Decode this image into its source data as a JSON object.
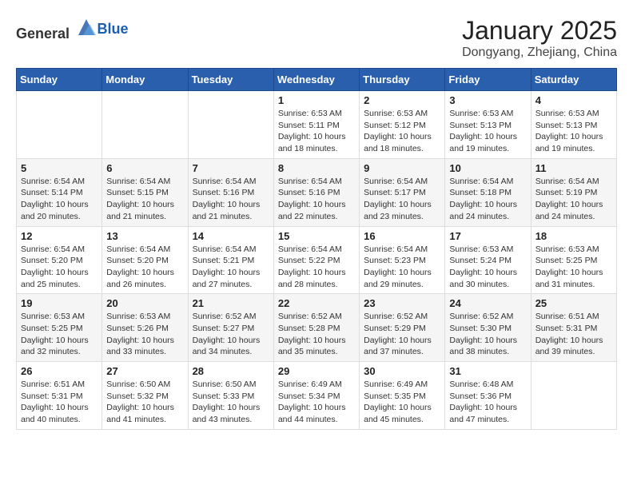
{
  "header": {
    "logo": {
      "general": "General",
      "blue": "Blue"
    },
    "month": "January 2025",
    "location": "Dongyang, Zhejiang, China"
  },
  "weekdays": [
    "Sunday",
    "Monday",
    "Tuesday",
    "Wednesday",
    "Thursday",
    "Friday",
    "Saturday"
  ],
  "weeks": [
    [
      {
        "day": "",
        "info": ""
      },
      {
        "day": "",
        "info": ""
      },
      {
        "day": "",
        "info": ""
      },
      {
        "day": "1",
        "info": "Sunrise: 6:53 AM\nSunset: 5:11 PM\nDaylight: 10 hours and 18 minutes."
      },
      {
        "day": "2",
        "info": "Sunrise: 6:53 AM\nSunset: 5:12 PM\nDaylight: 10 hours and 18 minutes."
      },
      {
        "day": "3",
        "info": "Sunrise: 6:53 AM\nSunset: 5:13 PM\nDaylight: 10 hours and 19 minutes."
      },
      {
        "day": "4",
        "info": "Sunrise: 6:53 AM\nSunset: 5:13 PM\nDaylight: 10 hours and 19 minutes."
      }
    ],
    [
      {
        "day": "5",
        "info": "Sunrise: 6:54 AM\nSunset: 5:14 PM\nDaylight: 10 hours and 20 minutes."
      },
      {
        "day": "6",
        "info": "Sunrise: 6:54 AM\nSunset: 5:15 PM\nDaylight: 10 hours and 21 minutes."
      },
      {
        "day": "7",
        "info": "Sunrise: 6:54 AM\nSunset: 5:16 PM\nDaylight: 10 hours and 21 minutes."
      },
      {
        "day": "8",
        "info": "Sunrise: 6:54 AM\nSunset: 5:16 PM\nDaylight: 10 hours and 22 minutes."
      },
      {
        "day": "9",
        "info": "Sunrise: 6:54 AM\nSunset: 5:17 PM\nDaylight: 10 hours and 23 minutes."
      },
      {
        "day": "10",
        "info": "Sunrise: 6:54 AM\nSunset: 5:18 PM\nDaylight: 10 hours and 24 minutes."
      },
      {
        "day": "11",
        "info": "Sunrise: 6:54 AM\nSunset: 5:19 PM\nDaylight: 10 hours and 24 minutes."
      }
    ],
    [
      {
        "day": "12",
        "info": "Sunrise: 6:54 AM\nSunset: 5:20 PM\nDaylight: 10 hours and 25 minutes."
      },
      {
        "day": "13",
        "info": "Sunrise: 6:54 AM\nSunset: 5:20 PM\nDaylight: 10 hours and 26 minutes."
      },
      {
        "day": "14",
        "info": "Sunrise: 6:54 AM\nSunset: 5:21 PM\nDaylight: 10 hours and 27 minutes."
      },
      {
        "day": "15",
        "info": "Sunrise: 6:54 AM\nSunset: 5:22 PM\nDaylight: 10 hours and 28 minutes."
      },
      {
        "day": "16",
        "info": "Sunrise: 6:54 AM\nSunset: 5:23 PM\nDaylight: 10 hours and 29 minutes."
      },
      {
        "day": "17",
        "info": "Sunrise: 6:53 AM\nSunset: 5:24 PM\nDaylight: 10 hours and 30 minutes."
      },
      {
        "day": "18",
        "info": "Sunrise: 6:53 AM\nSunset: 5:25 PM\nDaylight: 10 hours and 31 minutes."
      }
    ],
    [
      {
        "day": "19",
        "info": "Sunrise: 6:53 AM\nSunset: 5:25 PM\nDaylight: 10 hours and 32 minutes."
      },
      {
        "day": "20",
        "info": "Sunrise: 6:53 AM\nSunset: 5:26 PM\nDaylight: 10 hours and 33 minutes."
      },
      {
        "day": "21",
        "info": "Sunrise: 6:52 AM\nSunset: 5:27 PM\nDaylight: 10 hours and 34 minutes."
      },
      {
        "day": "22",
        "info": "Sunrise: 6:52 AM\nSunset: 5:28 PM\nDaylight: 10 hours and 35 minutes."
      },
      {
        "day": "23",
        "info": "Sunrise: 6:52 AM\nSunset: 5:29 PM\nDaylight: 10 hours and 37 minutes."
      },
      {
        "day": "24",
        "info": "Sunrise: 6:52 AM\nSunset: 5:30 PM\nDaylight: 10 hours and 38 minutes."
      },
      {
        "day": "25",
        "info": "Sunrise: 6:51 AM\nSunset: 5:31 PM\nDaylight: 10 hours and 39 minutes."
      }
    ],
    [
      {
        "day": "26",
        "info": "Sunrise: 6:51 AM\nSunset: 5:31 PM\nDaylight: 10 hours and 40 minutes."
      },
      {
        "day": "27",
        "info": "Sunrise: 6:50 AM\nSunset: 5:32 PM\nDaylight: 10 hours and 41 minutes."
      },
      {
        "day": "28",
        "info": "Sunrise: 6:50 AM\nSunset: 5:33 PM\nDaylight: 10 hours and 43 minutes."
      },
      {
        "day": "29",
        "info": "Sunrise: 6:49 AM\nSunset: 5:34 PM\nDaylight: 10 hours and 44 minutes."
      },
      {
        "day": "30",
        "info": "Sunrise: 6:49 AM\nSunset: 5:35 PM\nDaylight: 10 hours and 45 minutes."
      },
      {
        "day": "31",
        "info": "Sunrise: 6:48 AM\nSunset: 5:36 PM\nDaylight: 10 hours and 47 minutes."
      },
      {
        "day": "",
        "info": ""
      }
    ]
  ]
}
